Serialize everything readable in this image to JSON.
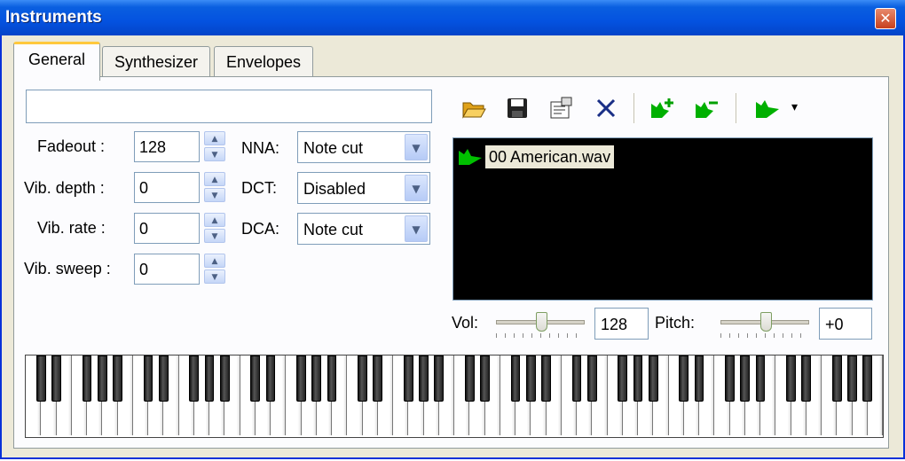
{
  "window": {
    "title": "Instruments",
    "close_glyph": "✕"
  },
  "tabs": [
    {
      "label": "General",
      "active": true
    },
    {
      "label": "Synthesizer",
      "active": false
    },
    {
      "label": "Envelopes",
      "active": false
    }
  ],
  "general": {
    "name_value": "",
    "fadeout": {
      "label": "Fadeout :",
      "value": "128"
    },
    "vib_depth": {
      "label": "Vib. depth :",
      "value": "0"
    },
    "vib_rate": {
      "label": "Vib. rate :",
      "value": "0"
    },
    "vib_sweep": {
      "label": "Vib. sweep :",
      "value": "0"
    },
    "nna": {
      "label": "NNA:",
      "value": "Note cut"
    },
    "dct": {
      "label": "DCT:",
      "value": "Disabled"
    },
    "dca": {
      "label": "DCA:",
      "value": "Note cut"
    }
  },
  "toolbar": {
    "icons": [
      "open-folder-icon",
      "save-icon",
      "properties-icon",
      "delete-icon",
      "add-sample-icon",
      "remove-sample-icon",
      "play-sample-icon"
    ],
    "dropdown_arrow": "▾"
  },
  "samples": [
    {
      "label": "00 American.wav",
      "selected": true
    }
  ],
  "volume": {
    "label": "Vol:",
    "value": "128",
    "slider_fraction": 0.5
  },
  "pitch": {
    "label": "Pitch:",
    "value": "+0",
    "slider_fraction": 0.5
  },
  "keyboard": {
    "white_keys": 56
  },
  "colors": {
    "title_bar": "#0452e0",
    "tab_highlight": "#ffc83c",
    "sample_list_bg": "#000000",
    "sample_icon": "#00c000"
  }
}
